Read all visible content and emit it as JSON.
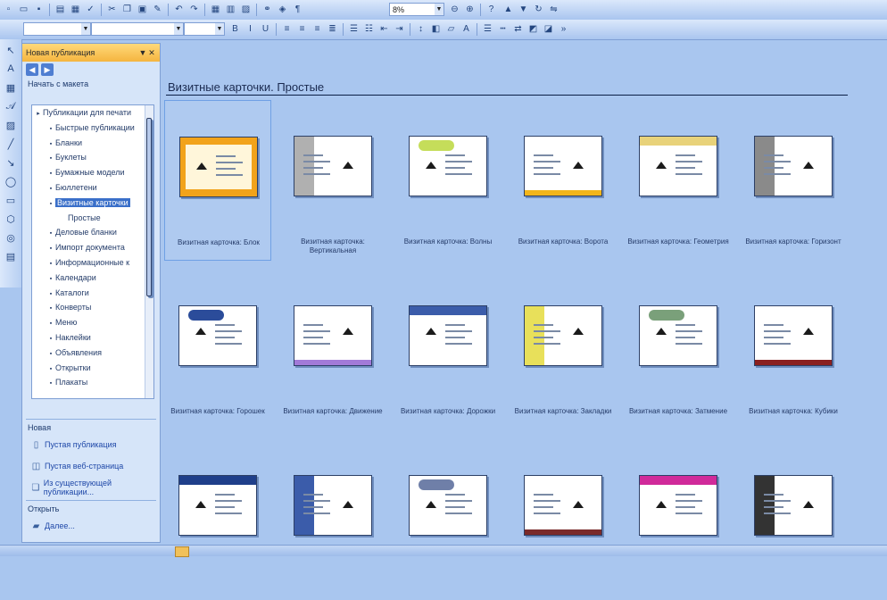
{
  "toolbar": {
    "zoom": "8%"
  },
  "taskpane": {
    "title": "Новая публикация",
    "section_start": "Начать с макета",
    "tree": [
      {
        "label": "Публикации для печати",
        "level": 0
      },
      {
        "label": "Быстрые публикации",
        "level": 1
      },
      {
        "label": "Бланки",
        "level": 1
      },
      {
        "label": "Буклеты",
        "level": 1
      },
      {
        "label": "Бумажные модели",
        "level": 1
      },
      {
        "label": "Бюллетени",
        "level": 1
      },
      {
        "label": "Визитные карточки",
        "level": 1,
        "selected": true
      },
      {
        "label": "Простые",
        "level": 2
      },
      {
        "label": "Деловые бланки",
        "level": 1
      },
      {
        "label": "Импорт документа",
        "level": 1
      },
      {
        "label": "Информационные к",
        "level": 1
      },
      {
        "label": "Календари",
        "level": 1
      },
      {
        "label": "Каталоги",
        "level": 1
      },
      {
        "label": "Конверты",
        "level": 1
      },
      {
        "label": "Меню",
        "level": 1
      },
      {
        "label": "Наклейки",
        "level": 1
      },
      {
        "label": "Объявления",
        "level": 1
      },
      {
        "label": "Открытки",
        "level": 1
      },
      {
        "label": "Плакаты",
        "level": 1
      }
    ],
    "section_new": "Новая",
    "new_links": [
      {
        "label": "Пустая публикация",
        "icon": "blank-doc-icon"
      },
      {
        "label": "Пустая веб-страница",
        "icon": "web-page-icon"
      },
      {
        "label": "Из существующей публикации...",
        "icon": "existing-doc-icon"
      }
    ],
    "section_open": "Открыть",
    "open_links": [
      {
        "label": "Далее...",
        "icon": "folder-icon"
      }
    ]
  },
  "gallery": {
    "title": "Визитные карточки. Простые",
    "templates": [
      {
        "name": "Визитная карточка: Блок",
        "accent": "#f2a31b"
      },
      {
        "name": "Визитная карточка: Вертикальная",
        "accent": "#b0b0b0"
      },
      {
        "name": "Визитная карточка: Волны",
        "accent": "#c5dd5a"
      },
      {
        "name": "Визитная карточка: Ворота",
        "accent": "#f2b51b"
      },
      {
        "name": "Визитная карточка: Геометрия",
        "accent": "#e8d27a"
      },
      {
        "name": "Визитная карточка: Горизонт",
        "accent": "#8a8a8a"
      },
      {
        "name": "Визитная карточка: Горошек",
        "accent": "#2b4c9a"
      },
      {
        "name": "Визитная карточка: Движение",
        "accent": "#a27ad8"
      },
      {
        "name": "Визитная карточка: Дорожки",
        "accent": "#3b5caa"
      },
      {
        "name": "Визитная карточка: Закладки",
        "accent": "#e8e05a"
      },
      {
        "name": "Визитная карточка: Затмение",
        "accent": "#7aa07a"
      },
      {
        "name": "Визитная карточка: Кубики",
        "accent": "#8a2020"
      },
      {
        "name": "",
        "accent": "#1f3f8a"
      },
      {
        "name": "",
        "accent": "#3b5caa"
      },
      {
        "name": "",
        "accent": "#6f7fa8"
      },
      {
        "name": "",
        "accent": "#7a2a2a"
      },
      {
        "name": "",
        "accent": "#d02a9a"
      },
      {
        "name": "",
        "accent": "#333333"
      }
    ]
  }
}
